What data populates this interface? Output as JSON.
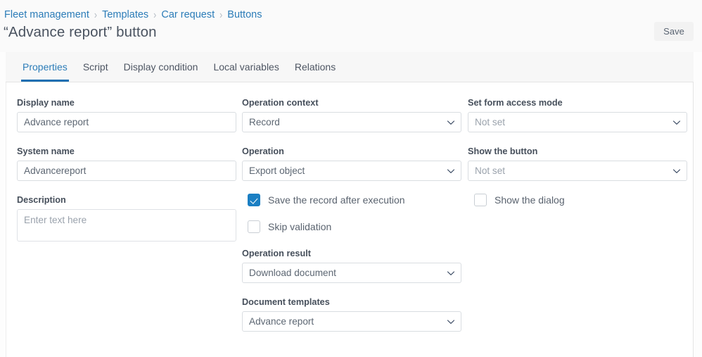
{
  "header": {
    "breadcrumb": [
      {
        "label": "Fleet management"
      },
      {
        "label": "Templates"
      },
      {
        "label": "Car request"
      },
      {
        "label": "Buttons"
      }
    ],
    "separator": "›",
    "title": "“Advance report” button",
    "save_label": "Save"
  },
  "tabs": [
    {
      "label": "Properties",
      "active": true
    },
    {
      "label": "Script",
      "active": false
    },
    {
      "label": "Display condition",
      "active": false
    },
    {
      "label": "Local variables",
      "active": false
    },
    {
      "label": "Relations",
      "active": false
    }
  ],
  "form": {
    "display_name": {
      "label": "Display name",
      "value": "Advance report"
    },
    "system_name": {
      "label": "System name",
      "value": "Advancereport"
    },
    "description": {
      "label": "Description",
      "value": "",
      "placeholder": "Enter text here"
    },
    "operation_context": {
      "label": "Operation context",
      "value": "Record"
    },
    "operation": {
      "label": "Operation",
      "value": "Export object"
    },
    "operation_result": {
      "label": "Operation result",
      "value": "Download document"
    },
    "document_templates": {
      "label": "Document templates",
      "value": "Advance report"
    },
    "set_form_access_mode": {
      "label": "Set form access mode",
      "value": "Not set"
    },
    "show_the_button": {
      "label": "Show the button",
      "value": "Not set"
    },
    "save_after_execution": {
      "label": "Save the record after execution",
      "checked": true
    },
    "skip_validation": {
      "label": "Skip validation",
      "checked": false
    },
    "show_the_dialog": {
      "label": "Show the dialog",
      "checked": false
    }
  },
  "colors": {
    "accent": "#1f6fb2",
    "link": "#2b7cb8",
    "checkbox_checked": "#1b7fc3",
    "label_text": "#464f5b",
    "value_text": "#5d6773",
    "placeholder_text": "#9aa2ac",
    "tabbar_bg": "#f7f7f7",
    "header_bg": "#fafafa",
    "border": "#d9dde1"
  },
  "icons": {
    "chevron_down": "chevron-down-icon",
    "breadcrumb_separator": "chevron-right-icon",
    "check": "check-icon"
  }
}
